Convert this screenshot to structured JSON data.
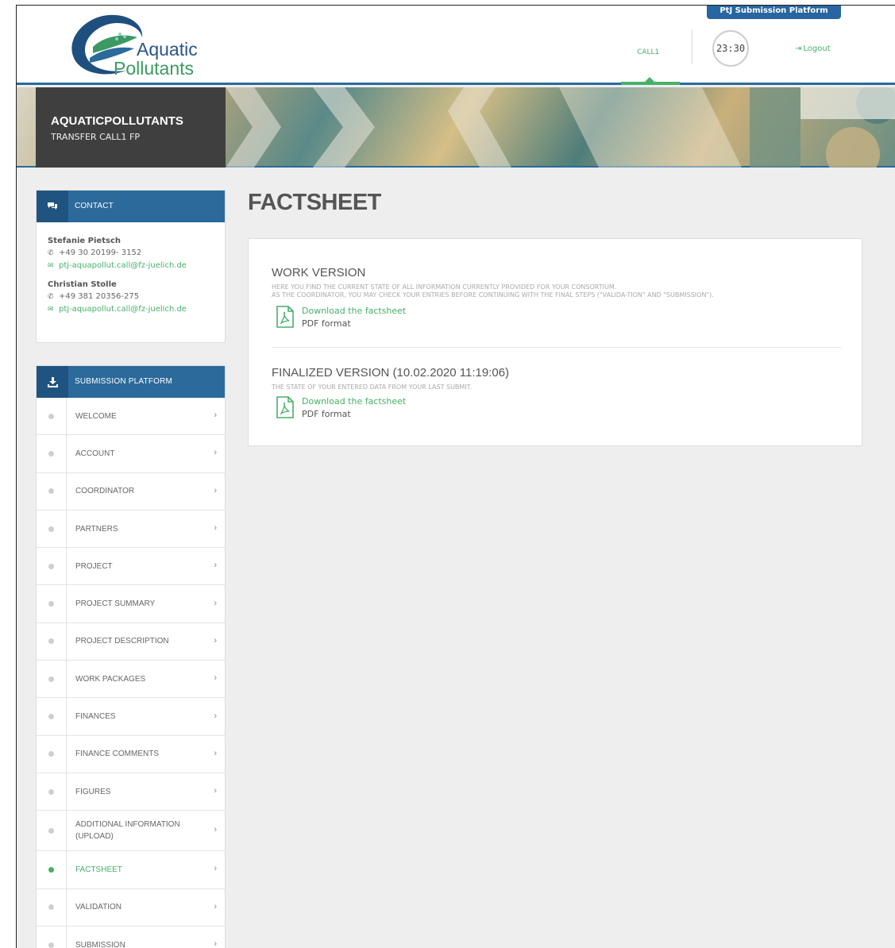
{
  "header": {
    "platform_tab": "PtJ Submission Platform",
    "logo_word1": "Aquatic",
    "logo_word2": "Pollutants",
    "nav_call": "CALL1",
    "timer": "23:30",
    "logout": "Logout"
  },
  "banner": {
    "title": "AQUATICPOLLUTANTS",
    "subtitle": "TRANSFER CALL1 FP"
  },
  "contact": {
    "header": "CONTACT",
    "persons": [
      {
        "name": "Stefanie Pietsch",
        "phone": "+49 30 20199- 3152",
        "email": "ptj-aquapollut.call@fz-juelich.de"
      },
      {
        "name": "Christian Stolle",
        "phone": "+49 381 20356-275",
        "email": "ptj-aquapollut.call@fz-juelich.de"
      }
    ]
  },
  "submission": {
    "header": "SUBMISSION PLATFORM",
    "items": [
      {
        "label": "WELCOME"
      },
      {
        "label": "ACCOUNT"
      },
      {
        "label": "COORDINATOR"
      },
      {
        "label": "PARTNERS"
      },
      {
        "label": "PROJECT"
      },
      {
        "label": "PROJECT SUMMARY"
      },
      {
        "label": "PROJECT DESCRIPTION"
      },
      {
        "label": "WORK PACKAGES"
      },
      {
        "label": "FINANCES"
      },
      {
        "label": "FINANCE COMMENTS"
      },
      {
        "label": "FIGURES"
      },
      {
        "label": "ADDITIONAL INFORMATION (UPLOAD)"
      },
      {
        "label": "FACTSHEET"
      },
      {
        "label": "VALIDATION"
      },
      {
        "label": "SUBMISSION"
      }
    ]
  },
  "main": {
    "title": "FACTSHEET",
    "work": {
      "title": "WORK VERSION",
      "desc1": "HERE YOU FIND THE CURRENT STATE OF ALL INFORMATION CURRENTLY PROVIDED FOR YOUR CONSORTIUM.",
      "desc2": "AS THE COORDINATOR, YOU MAY CHECK YOUR ENTRIES BEFORE CONTINUING WITH THE FINAL STEPS (\"VALIDA-TION\" AND \"SUBMISSION\").",
      "link": "Download the factsheet",
      "format": "PDF format"
    },
    "final": {
      "title": "FINALIZED VERSION (10.02.2020 11:19:06)",
      "desc": "THE STATE OF YOUR ENTERED DATA FROM YOUR LAST SUBMIT.",
      "link": "Download the factsheet",
      "format": "PDF format"
    }
  },
  "colors": {
    "brand_blue": "#2b6a9a",
    "accent_green": "#46b06a"
  }
}
